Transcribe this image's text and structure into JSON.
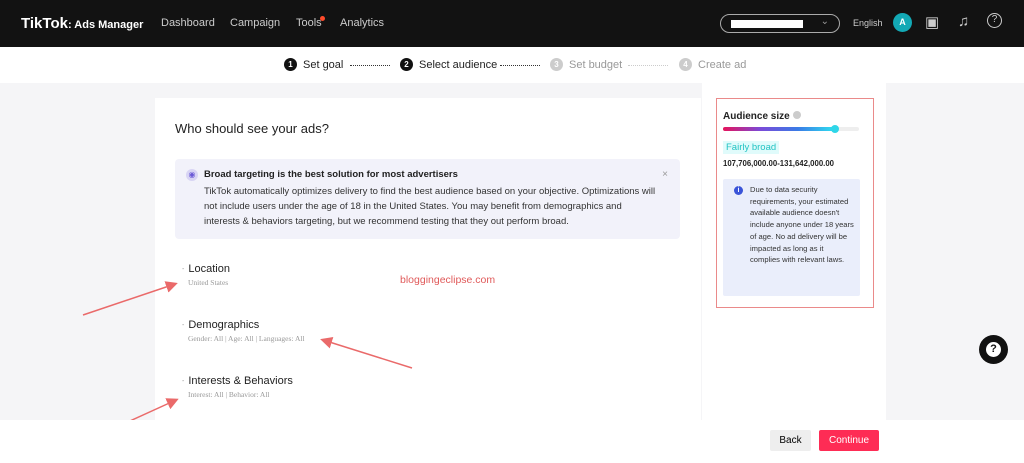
{
  "header": {
    "logo": "TikTok",
    "logo_sub": ": Ads Manager",
    "nav": [
      "Dashboard",
      "Campaign",
      "Tools",
      "Analytics"
    ],
    "language": "English",
    "avatar": "A"
  },
  "steps": [
    {
      "num": "1",
      "label": "Set goal"
    },
    {
      "num": "2",
      "label": "Select audience"
    },
    {
      "num": "3",
      "label": "Set budget"
    },
    {
      "num": "4",
      "label": "Create ad"
    }
  ],
  "main": {
    "title": "Who should see your ads?",
    "tip": {
      "title": "Broad targeting is the best solution for most advertisers",
      "body": "TikTok automatically optimizes delivery to find the best audience based on your objective. Optimizations will not include users under the age of 18 in the United States. You may benefit from demographics and interests & behaviors targeting, but we recommend testing that they out perform broad.",
      "close": "×"
    },
    "sections": [
      {
        "title": "Location",
        "summary": "United States"
      },
      {
        "title": "Demographics",
        "summary": "Gender: All | Age: All | Languages: All"
      },
      {
        "title": "Interests & Behaviors",
        "summary": "Interest: All | Behavior: All"
      }
    ],
    "watermark": "bloggingeclipse.com"
  },
  "audience": {
    "title": "Audience size",
    "level_percent": 82,
    "label": "Fairly broad",
    "range": "107,706,000.00-131,642,000.00",
    "note": "Due to data security requirements, your estimated available audience doesn't include anyone under 18 years of age. No ad delivery will be impacted as long as it complies with relevant laws."
  },
  "footer": {
    "back": "Back",
    "continue": "Continue"
  },
  "help": "?",
  "colors": {
    "accent": "#fe2c55",
    "annotation": "#e05a5a",
    "badge": "#22c3c3"
  }
}
